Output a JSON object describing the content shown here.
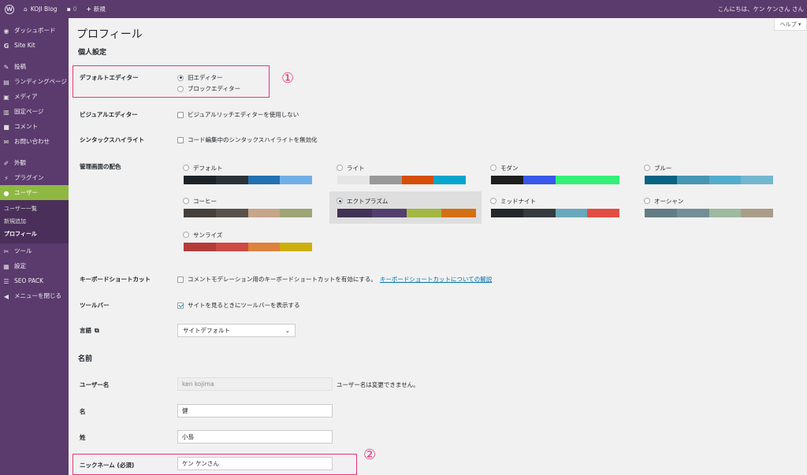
{
  "adminbar": {
    "site_name": "KOJI Blog",
    "comments_count": "0",
    "new_label": "新規",
    "greeting": "こんにちは、ケン ケンさん さん"
  },
  "sidebar": {
    "items": [
      {
        "label": "ダッシュボード",
        "icon": "dashboard-icon"
      },
      {
        "label": "Site Kit",
        "icon": "sitekit-g-icon"
      },
      {
        "label": "投稿",
        "icon": "pin-icon"
      },
      {
        "label": "ランディングページ",
        "icon": "landing-icon"
      },
      {
        "label": "メディア",
        "icon": "media-icon"
      },
      {
        "label": "固定ページ",
        "icon": "page-icon"
      },
      {
        "label": "コメント",
        "icon": "comment-icon"
      },
      {
        "label": "お問い合わせ",
        "icon": "mail-icon"
      },
      {
        "label": "外観",
        "icon": "appearance-icon"
      },
      {
        "label": "プラグイン",
        "icon": "plugin-icon"
      },
      {
        "label": "ユーザー",
        "icon": "user-icon"
      },
      {
        "label": "ツール",
        "icon": "wrench-icon"
      },
      {
        "label": "設定",
        "icon": "settings-icon"
      },
      {
        "label": "SEO PACK",
        "icon": "seo-icon"
      },
      {
        "label": "メニューを閉じる",
        "icon": "collapse-icon"
      }
    ],
    "users_submenu": [
      "ユーザー一覧",
      "新規追加",
      "プロフィール"
    ]
  },
  "main": {
    "help_label": "ヘルプ ▾",
    "page_title": "プロフィール",
    "personal_heading": "個人設定",
    "default_editor": {
      "label": "デフォルトエディター",
      "options": [
        "旧エディター",
        "ブロックエディター"
      ],
      "selected": "旧エディター"
    },
    "visual_editor": {
      "label": "ビジュアルエディター",
      "text": "ビジュアルリッチエディターを使用しない",
      "checked": false
    },
    "syntax": {
      "label": "シンタックスハイライト",
      "text": "コード編集中のシンタックスハイライトを無効化",
      "checked": false
    },
    "color_scheme": {
      "label": "管理画面の配色",
      "selected": "エクトプラズム",
      "schemes": [
        {
          "name": "デフォルト",
          "colors": [
            "#1d2327",
            "#2c3338",
            "#2271b1",
            "#72aee6"
          ]
        },
        {
          "name": "ライト",
          "colors": [
            "#e5e5e5",
            "#999999",
            "#d64e07",
            "#04a4cc"
          ]
        },
        {
          "name": "モダン",
          "colors": [
            "#1e1e1e",
            "#3858e9",
            "#33f078",
            "#33f078"
          ]
        },
        {
          "name": "ブルー",
          "colors": [
            "#096484",
            "#4796b3",
            "#52accc",
            "#74b6ce"
          ]
        },
        {
          "name": "コーヒー",
          "colors": [
            "#46403c",
            "#59524c",
            "#c7a589",
            "#9ea476"
          ]
        },
        {
          "name": "エクトプラズム",
          "colors": [
            "#413256",
            "#523f6d",
            "#a3b745",
            "#d46f15"
          ]
        },
        {
          "name": "ミッドナイト",
          "colors": [
            "#25282b",
            "#363b3f",
            "#69a8bb",
            "#e14d43"
          ]
        },
        {
          "name": "オーシャン",
          "colors": [
            "#627c83",
            "#738e96",
            "#9ebaa0",
            "#aa9d88"
          ]
        },
        {
          "name": "サンライズ",
          "colors": [
            "#b43c38",
            "#cf4944",
            "#dd823b",
            "#ccaf0b"
          ]
        }
      ]
    },
    "keyboard": {
      "label": "キーボードショートカット",
      "text": "コメントモデレーション用のキーボードショートカットを有効にする。",
      "link": "キーボードショートカットについての解説",
      "checked": false
    },
    "toolbar": {
      "label": "ツールバー",
      "text": "サイトを見るときにツールバーを表示する",
      "checked": true
    },
    "language": {
      "label": "言語",
      "value": "サイトデフォルト"
    },
    "name_heading": "名前",
    "username": {
      "label": "ユーザー名",
      "value": "ken kojima",
      "note": "ユーザー名は変更できません。"
    },
    "first_name": {
      "label": "名",
      "value": "健"
    },
    "last_name": {
      "label": "姓",
      "value": "小島"
    },
    "nickname": {
      "label": "ニックネーム (必須)",
      "value": "ケン ケンさん"
    },
    "annotations": [
      "①",
      "②"
    ]
  },
  "colors": {
    "admin_bg": "#5b3a6e",
    "accent": "#8fb843",
    "highlight": "#e8357a"
  }
}
